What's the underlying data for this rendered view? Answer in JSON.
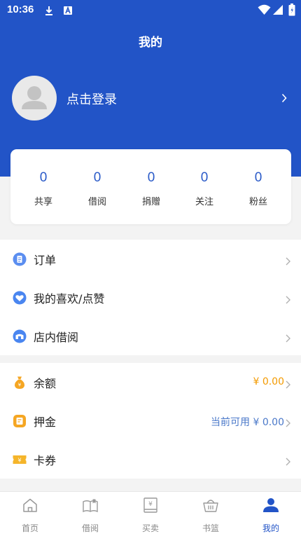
{
  "status_bar": {
    "time": "10:36"
  },
  "header": {
    "title": "我的",
    "login_text": "点击登录"
  },
  "stats": [
    {
      "value": "0",
      "label": "共享"
    },
    {
      "value": "0",
      "label": "借阅"
    },
    {
      "value": "0",
      "label": "捐赠"
    },
    {
      "value": "0",
      "label": "关注"
    },
    {
      "value": "0",
      "label": "粉丝"
    }
  ],
  "menu_group_1": [
    {
      "label": "订单",
      "icon": "order-icon"
    },
    {
      "label": "我的喜欢/点赞",
      "icon": "heart-icon"
    },
    {
      "label": "店内借阅",
      "icon": "store-borrow-icon"
    }
  ],
  "menu_group_2": [
    {
      "label": "余额",
      "icon": "money-bag-icon",
      "value": "¥ 0.00"
    },
    {
      "label": "押金",
      "icon": "deposit-icon",
      "value": "当前可用 ¥ 0.00"
    },
    {
      "label": "卡券",
      "icon": "coupon-icon"
    }
  ],
  "tabbar": [
    {
      "label": "首页",
      "icon": "home-icon"
    },
    {
      "label": "借阅",
      "icon": "borrow-book-icon"
    },
    {
      "label": "买卖",
      "icon": "buy-sell-book-icon"
    },
    {
      "label": "书篮",
      "icon": "basket-icon"
    },
    {
      "label": "我的",
      "icon": "profile-icon",
      "active": true
    }
  ],
  "colors": {
    "header_bg": "#2254c7",
    "accent_blue": "#2a5ac8",
    "balance_orange": "#f39a00",
    "deposit_blue": "#4a78c9",
    "tab_inactive": "#888888"
  }
}
